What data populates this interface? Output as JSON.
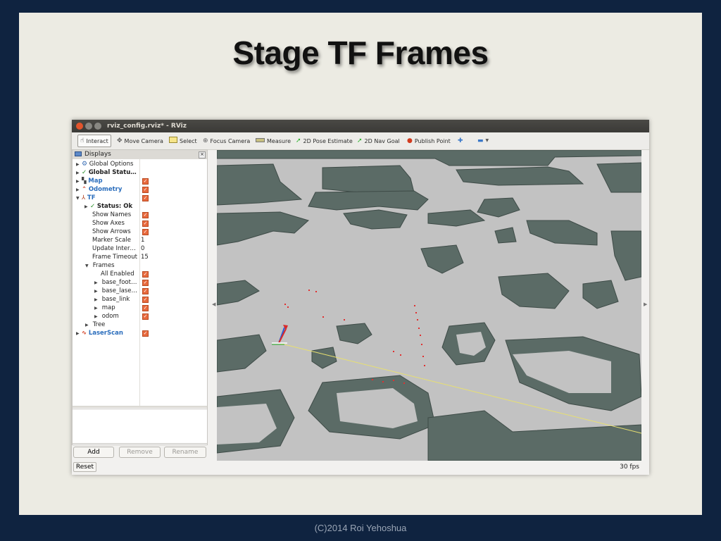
{
  "slide": {
    "title": "Stage TF Frames",
    "footer": "(C)2014 Roi Yehoshua"
  },
  "window": {
    "title": "rviz_config.rviz* - RViz"
  },
  "toolbar": {
    "tools": [
      {
        "label": "Interact",
        "icon": "hand-icon"
      },
      {
        "label": "Move Camera",
        "icon": "move-camera-icon"
      },
      {
        "label": "Select",
        "icon": "select-icon"
      },
      {
        "label": "Focus Camera",
        "icon": "focus-camera-icon"
      },
      {
        "label": "Measure",
        "icon": "ruler-icon"
      },
      {
        "label": "2D Pose Estimate",
        "icon": "green-arrow-icon"
      },
      {
        "label": "2D Nav Goal",
        "icon": "green-arrow-icon"
      },
      {
        "label": "Publish Point",
        "icon": "map-pin-icon"
      }
    ]
  },
  "displays": {
    "title": "Displays",
    "rows": [
      {
        "label": "Global Options"
      },
      {
        "label": "Global Statu…"
      },
      {
        "label": "Map"
      },
      {
        "label": "Odometry"
      },
      {
        "label": "TF"
      },
      {
        "label": "Status: Ok"
      },
      {
        "label": "Show Names"
      },
      {
        "label": "Show Axes"
      },
      {
        "label": "Show Arrows"
      },
      {
        "label": "Marker Scale",
        "value": "1"
      },
      {
        "label": "Update Inter…",
        "value": "0"
      },
      {
        "label": "Frame Timeout",
        "value": "15"
      },
      {
        "label": "Frames"
      },
      {
        "label": "All Enabled"
      },
      {
        "label": "base_foot…"
      },
      {
        "label": "base_lase…"
      },
      {
        "label": "base_link"
      },
      {
        "label": "map"
      },
      {
        "label": "odom"
      },
      {
        "label": "Tree"
      },
      {
        "label": "LaserScan"
      }
    ]
  },
  "buttons": {
    "add": "Add",
    "remove": "Remove",
    "rename": "Rename",
    "reset": "Reset"
  },
  "status": {
    "fps": "30 fps"
  },
  "colors": {
    "map_free": "#c0c0c0",
    "map_obstacle": "#5b6b66",
    "laser": "#e03030",
    "path": "#e8e070"
  }
}
